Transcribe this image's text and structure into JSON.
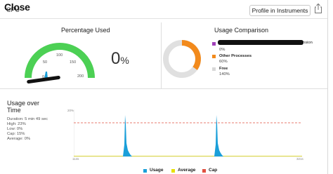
{
  "header": {
    "close_label": "Close",
    "close_under": "CPU",
    "profile_button": "Profile in Instruments",
    "share_icon": "share-icon"
  },
  "percentage_used": {
    "title": "Percentage Used",
    "ticks": [
      "50",
      "100",
      "150",
      "200"
    ],
    "zero_tick": "0",
    "value": "0",
    "unit": "%",
    "gauge_fill_fraction": 0.0,
    "colors": {
      "gauge": "#4cd054",
      "needle": "#1a9fd9"
    }
  },
  "usage_comparison": {
    "title": "Usage Comparison",
    "items": [
      {
        "name": "",
        "value": "0%",
        "color": "#a040b8"
      },
      {
        "name": "Other Processes",
        "value": "60%",
        "color": "#f28a1c"
      },
      {
        "name": "Free",
        "value": "140%",
        "color": "#d8d8d8"
      }
    ],
    "name_suffix": "nsion"
  },
  "usage_over_time": {
    "title_line1": "Usage over",
    "title_line2": "Time",
    "stats": {
      "duration": "Duration: 5 min 49 sec",
      "high": "High: 23%",
      "low": "Low: 0%",
      "cap": "Cap: 15%",
      "average": "Average: 0%"
    },
    "y_label": "20%",
    "x_start": "114s",
    "x_end": "321s",
    "legend": [
      {
        "label": "Usage",
        "color": "#1a9fd9"
      },
      {
        "label": "Average",
        "color": "#e8e000"
      },
      {
        "label": "Cap",
        "color": "#e05040"
      }
    ]
  }
}
